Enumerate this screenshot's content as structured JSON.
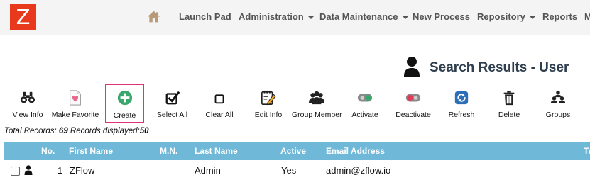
{
  "logo": {
    "text": "Z",
    "color": "#e8391d"
  },
  "nav": {
    "home_icon": "home-icon",
    "items": [
      {
        "label": "Launch Pad",
        "dropdown": false
      },
      {
        "label": "Administration",
        "dropdown": true
      },
      {
        "label": "Data Maintenance",
        "dropdown": true
      },
      {
        "label": "New Process",
        "dropdown": false
      },
      {
        "label": "Repository",
        "dropdown": true
      },
      {
        "label": "Reports",
        "dropdown": false
      },
      {
        "label": "M",
        "dropdown": false
      }
    ]
  },
  "page": {
    "title": "Search Results - User",
    "title_icon": "user-icon"
  },
  "toolbar": {
    "view_info": "View Info",
    "make_favorite": "Make Favorite",
    "create": "Create",
    "select_all": "Select All",
    "clear_all": "Clear All",
    "edit_info": "Edit Info",
    "group_member": "Group Member",
    "activate": "Activate",
    "deactivate": "Deactivate",
    "refresh": "Refresh",
    "delete": "Delete",
    "groups": "Groups"
  },
  "records": {
    "total_label": "Total Records: ",
    "total": "69",
    "displayed_label": " Records displayed:",
    "displayed": "50"
  },
  "table": {
    "headers": {
      "no": "No.",
      "first_name": "First Name",
      "mn": "M.N.",
      "last_name": "Last Name",
      "active": "Active",
      "email": "Email Address",
      "overflow": "Te"
    },
    "rows": [
      {
        "no": "1",
        "first_name": "ZFlow",
        "mn": "",
        "last_name": "Admin",
        "active": "Yes",
        "email": "admin@zflow.io"
      }
    ]
  },
  "colors": {
    "accent_header": "#6fb8d8",
    "highlight_border": "#e0327a",
    "create_green": "#3aa76d",
    "title_color": "#2e3e4e"
  }
}
